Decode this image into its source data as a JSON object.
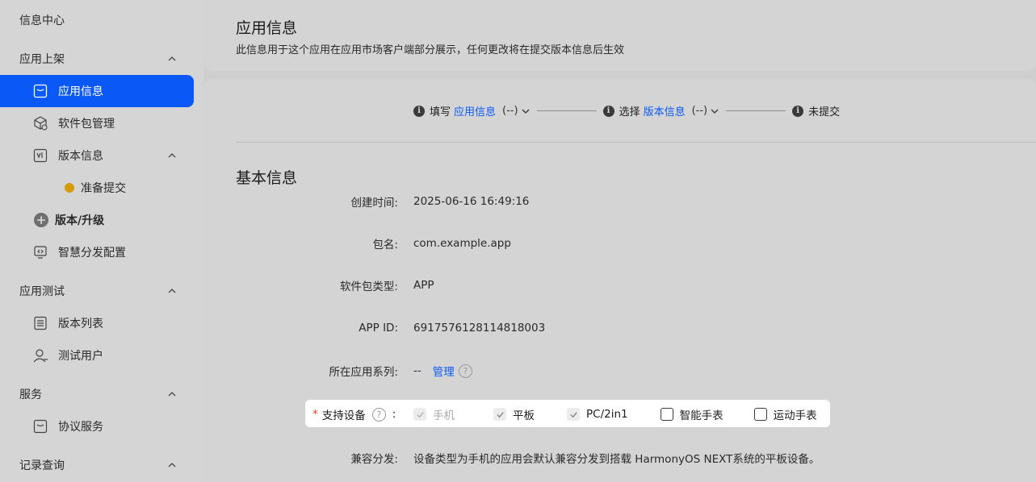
{
  "sidebar": {
    "info_center": "信息中心",
    "group_publish": "应用上架",
    "app_info": "应用信息",
    "package_mgmt": "软件包管理",
    "version_info": "版本信息",
    "prepare_submit": "准备提交",
    "version_upgrade": "版本/升级",
    "smart_distribution": "智慧分发配置",
    "group_testing": "应用测试",
    "version_list": "版本列表",
    "test_users": "测试用户",
    "group_service": "服务",
    "agreement_service": "协议服务",
    "group_records": "记录查询",
    "accent_color": "#0a59f7",
    "status_dot_color": "#d69b0b"
  },
  "header": {
    "title": "应用信息",
    "subtitle": "此信息用于这个应用在应用市场客户端部分展示，任何更改将在提交版本信息后生效"
  },
  "steps": [
    {
      "prefix": "填写",
      "link": "应用信息",
      "status": "(--)"
    },
    {
      "prefix": "选择",
      "link": "版本信息",
      "status": "(--)"
    },
    {
      "prefix": "未提交"
    }
  ],
  "basic_info": {
    "title": "基本信息",
    "fields": {
      "created_label": "创建时间:",
      "created_value": "2025-06-16 16:49:16",
      "package_label": "包名:",
      "package_value": "com.example.app",
      "pkg_type_label": "软件包类型:",
      "pkg_type_value": "APP",
      "app_id_label": "APP ID:",
      "app_id_value": "6917576128114818003",
      "series_label": "所在应用系列:",
      "series_value": "--",
      "series_manage": "管理",
      "compat_label": "兼容分发:",
      "compat_value": "设备类型为手机的应用会默认兼容分发到搭载 HarmonyOS NEXT系统的平板设备。"
    },
    "devices": {
      "required_mark": "*",
      "label": "支持设备",
      "colon": ":",
      "options": [
        {
          "label": "手机",
          "checked": true,
          "disabled": true
        },
        {
          "label": "平板",
          "checked": true,
          "disabled": false
        },
        {
          "label": "PC/2in1",
          "checked": true,
          "disabled": false
        },
        {
          "label": "智能手表",
          "checked": false,
          "disabled": false
        },
        {
          "label": "运动手表",
          "checked": false,
          "disabled": false
        }
      ]
    }
  }
}
